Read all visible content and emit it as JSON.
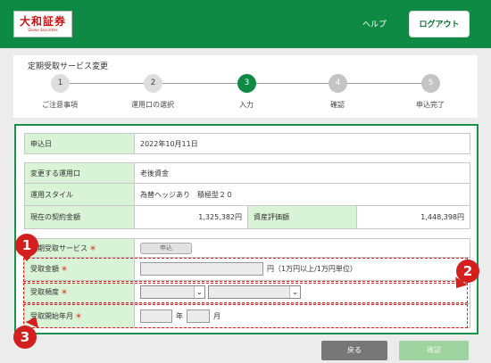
{
  "header": {
    "logo_main": "大和証券",
    "logo_sub": "Daiwa Securities",
    "help_label": "ヘルプ",
    "logout_label": "ログアウト",
    "bg_color": "#0f8a45"
  },
  "stepper": {
    "title": "定期受取サービス変更",
    "current_step": 3,
    "steps": [
      {
        "number": "1",
        "label": "ご注意事項",
        "state": "done"
      },
      {
        "number": "2",
        "label": "運用口の選択",
        "state": "done"
      },
      {
        "number": "3",
        "label": "入力",
        "state": "current"
      },
      {
        "number": "4",
        "label": "確認",
        "state": "todo"
      },
      {
        "number": "5",
        "label": "申込完了",
        "state": "todo"
      }
    ]
  },
  "form": {
    "application_date": {
      "label": "申込日",
      "value": "2022年10月11日"
    },
    "account": {
      "label": "変更する運用口",
      "value": "老後資金"
    },
    "style": {
      "label": "運用スタイル",
      "value": "為替ヘッジあり　積極型２０"
    },
    "contract": {
      "label": "現在の契約金額",
      "value": "1,325,382円",
      "eval_label": "資産評価額",
      "eval_value": "1,448,398円"
    },
    "service": {
      "label": "定期受取サービス",
      "button": "申込"
    },
    "amount": {
      "label": "受取金額",
      "value": "",
      "suffix": "円（1万円以上/1万円単位）"
    },
    "frequency": {
      "label": "受取頻度",
      "select1": "",
      "select2": ""
    },
    "start": {
      "label": "受取開始年月",
      "year_value": "",
      "year_suffix": "年",
      "month_value": "",
      "month_suffix": "月"
    },
    "required_mark": "＊"
  },
  "annotations": {
    "markers": [
      "1",
      "2",
      "3"
    ],
    "color": "#d41f1f"
  },
  "footer": {
    "back_label": "戻る",
    "confirm_label": "確認"
  }
}
